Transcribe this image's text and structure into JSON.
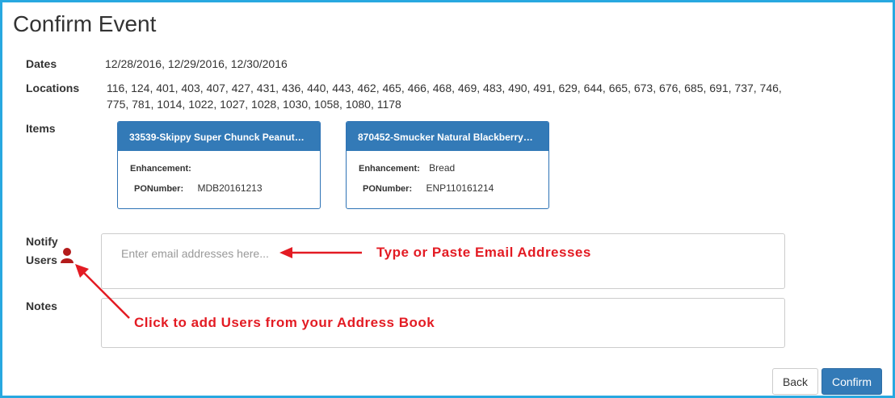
{
  "page": {
    "title": "Confirm Event"
  },
  "fields": {
    "dates_label": "Dates",
    "dates_value": "12/28/2016, 12/29/2016, 12/30/2016",
    "locations_label": "Locations",
    "locations_line1": "116, 124, 401, 403, 407, 427, 431, 436, 440, 443, 462, 465, 466, 468, 469, 483, 490, 491, 629, 644, 665, 673, 676, 685, 691, 737, 746,",
    "locations_line2": "775, 781, 1014, 1022, 1027, 1028, 1030, 1058, 1080, 1178",
    "items_label": "Items",
    "notify_label_1": "Notify",
    "notify_label_2": "Users",
    "notes_label": "Notes"
  },
  "items": [
    {
      "title": "33539-Skippy Super Chunck Peanut…",
      "enhancement_label": "Enhancement:",
      "enhancement_value": "",
      "ponumber_label": "PONumber:",
      "ponumber_value": "MDB20161213"
    },
    {
      "title": "870452-Smucker Natural Blackberry…",
      "enhancement_label": "Enhancement:",
      "enhancement_value": "Bread",
      "ponumber_label": "PONumber:",
      "ponumber_value": "ENP110161214"
    }
  ],
  "email_input": {
    "placeholder": "Enter email addresses here..."
  },
  "annotations": {
    "email_hint": "Type or Paste Email Addresses",
    "addressbook_hint": "Click to add Users from your Address Book"
  },
  "buttons": {
    "back": "Back",
    "confirm": "Confirm"
  },
  "icons": {
    "address_book": "user-icon"
  },
  "colors": {
    "frame": "#28a8e0",
    "primary": "#337ab7",
    "annotation": "#e31b23",
    "user_icon": "#b31b1b"
  }
}
